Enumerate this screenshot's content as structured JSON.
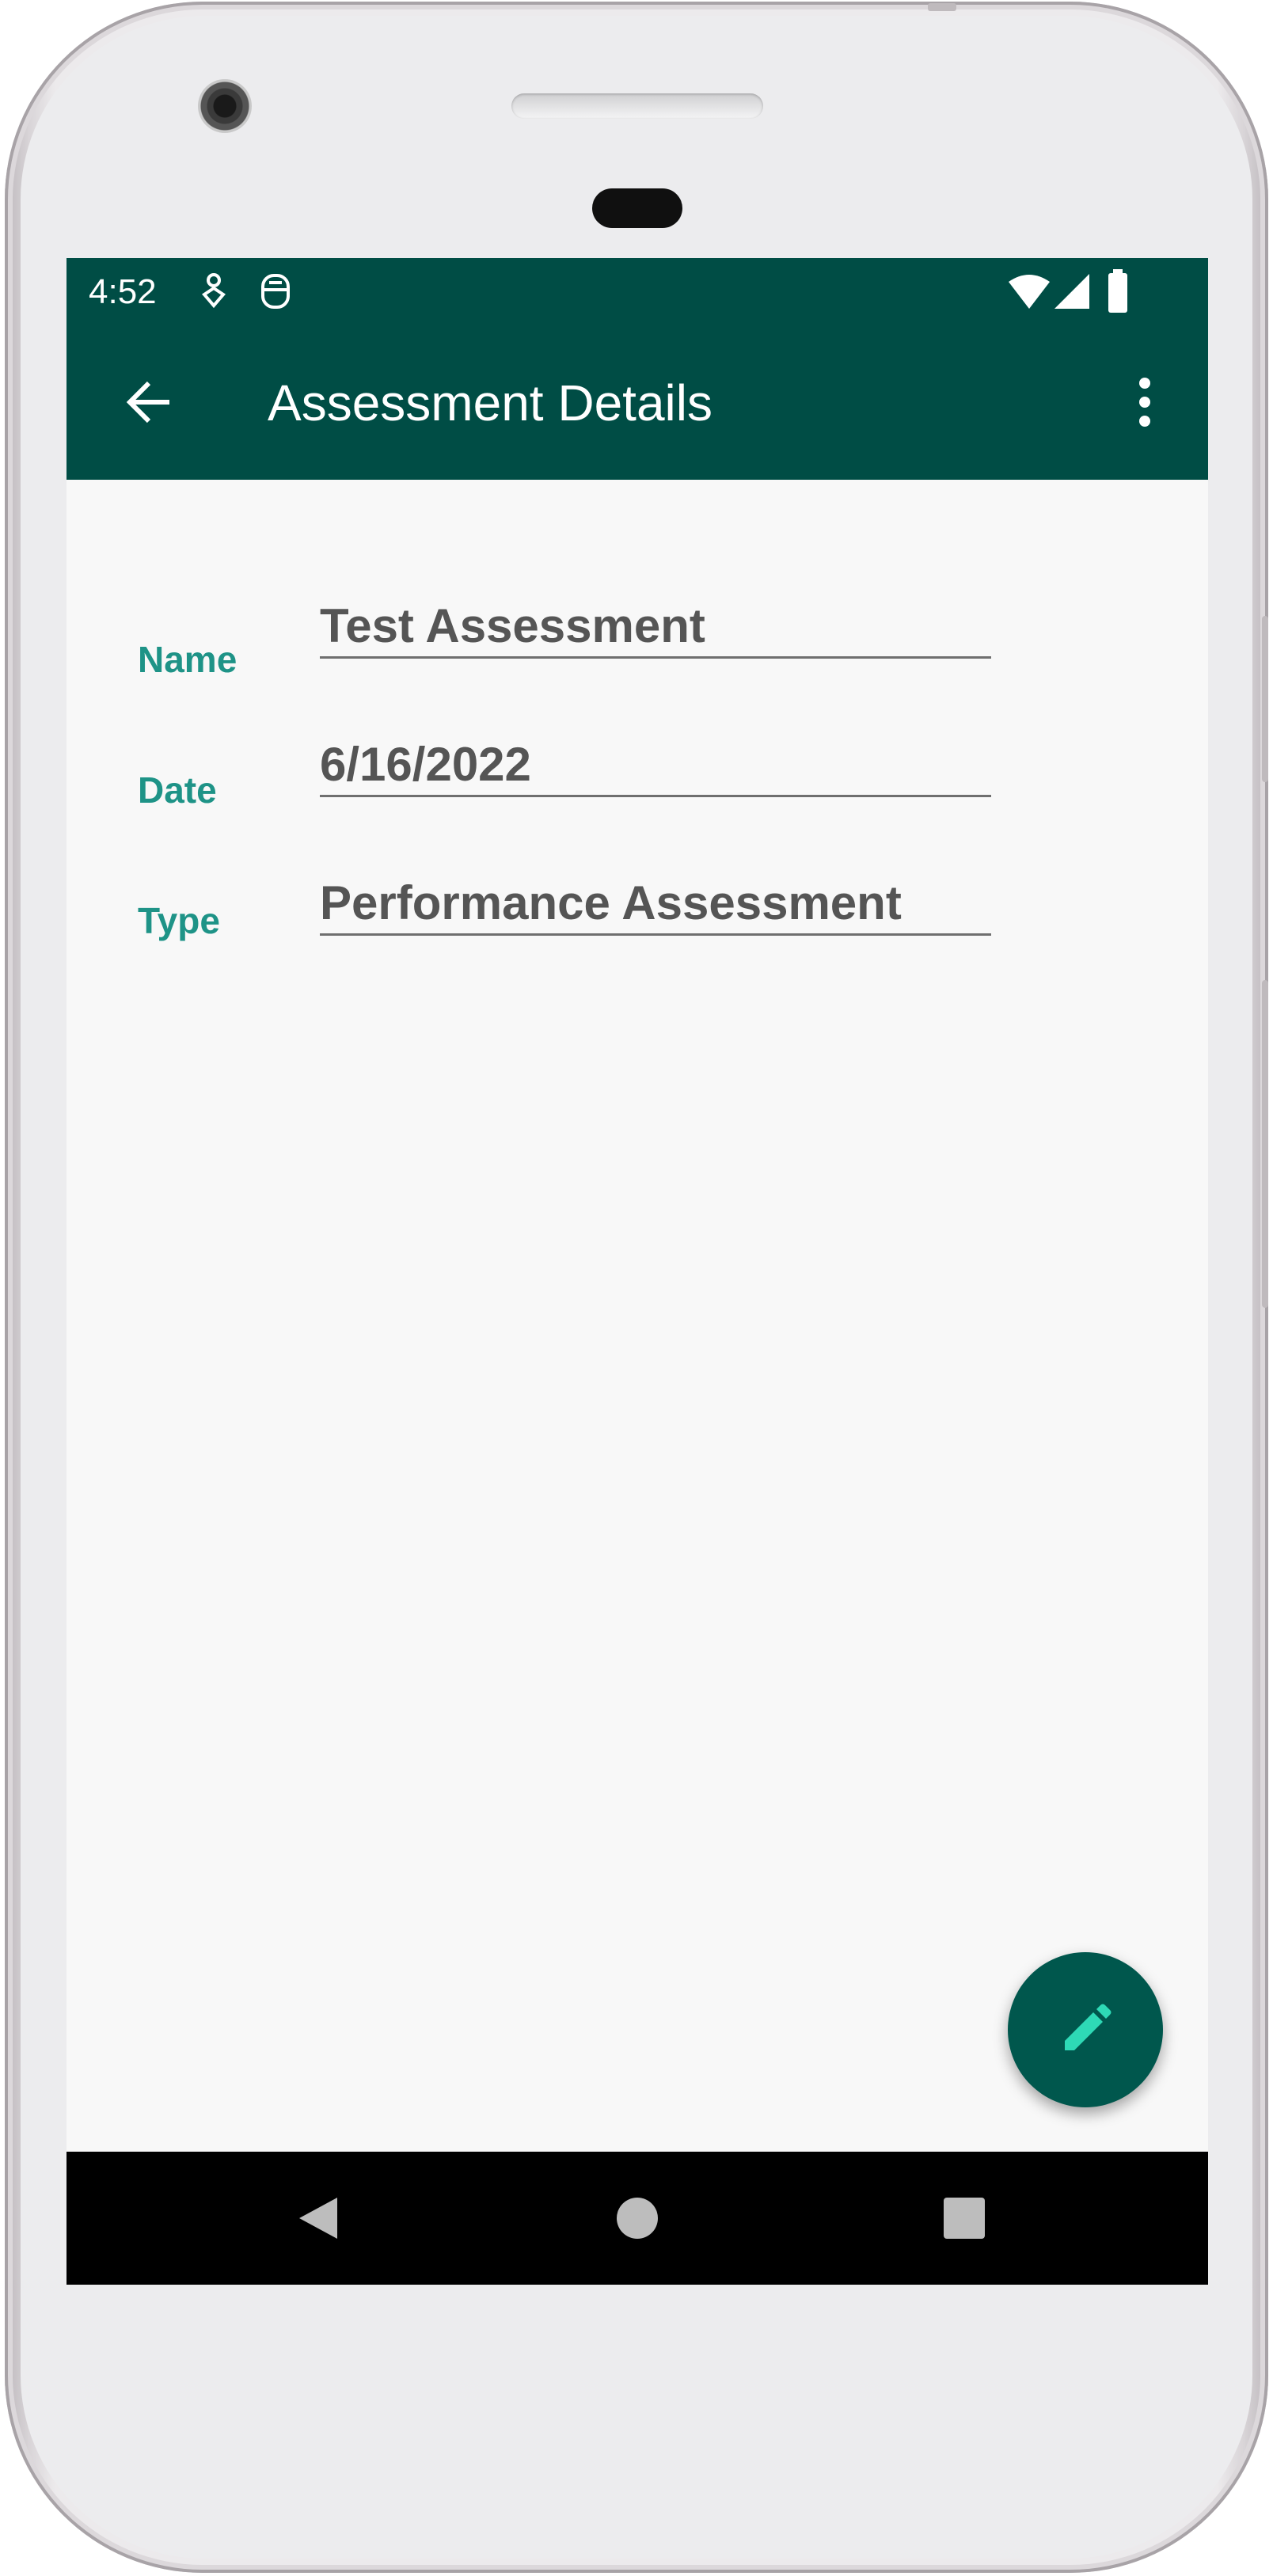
{
  "status_bar": {
    "time": "4:52",
    "left_icons": [
      "notification-app-icon",
      "sim-card-icon"
    ],
    "right_icons": [
      "wifi-icon",
      "cell-signal-icon",
      "battery-icon"
    ]
  },
  "app_bar": {
    "title": "Assessment Details",
    "back_icon": "arrow-back-icon",
    "menu_icon": "more-vert-icon"
  },
  "form": {
    "fields": [
      {
        "label": "Name",
        "value": "Test Assessment"
      },
      {
        "label": "Date",
        "value": "6/16/2022"
      },
      {
        "label": "Type",
        "value": "Performance Assessment"
      }
    ]
  },
  "fab": {
    "icon": "edit-pencil-icon"
  },
  "nav_bar": {
    "buttons": [
      "back-triangle-icon",
      "home-circle-icon",
      "recents-square-icon"
    ]
  },
  "colors": {
    "primary_dark": "#004d45",
    "label_accent": "#1e9387",
    "fab_icon": "#2ed9b6",
    "text_value": "#555555",
    "background": "#f8f8f8"
  }
}
